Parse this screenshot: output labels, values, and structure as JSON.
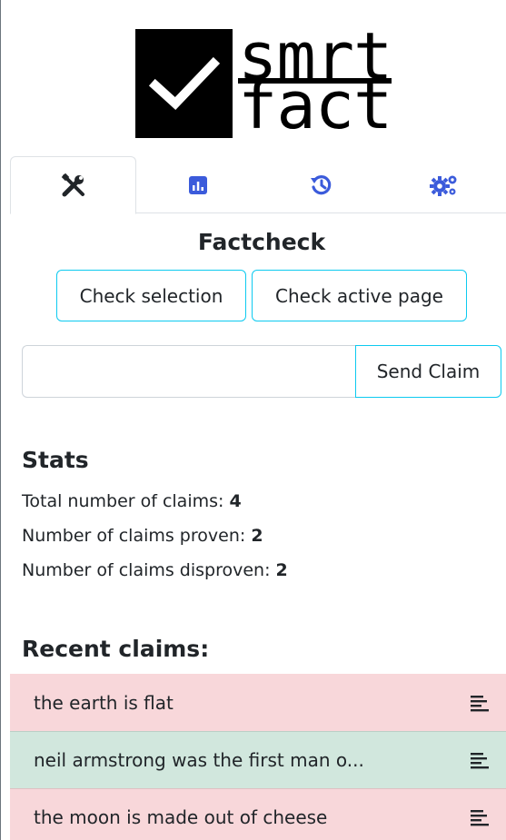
{
  "logo": {
    "line1": "smrt",
    "line2": "fact"
  },
  "tabs": [
    {
      "name": "tools",
      "icon": "tools-icon"
    },
    {
      "name": "stats",
      "icon": "bar-chart-icon"
    },
    {
      "name": "history",
      "icon": "history-icon"
    },
    {
      "name": "settings",
      "icon": "gears-icon"
    }
  ],
  "factcheck": {
    "title": "Factcheck",
    "check_selection_label": "Check selection",
    "check_page_label": "Check active page",
    "claim_value": "",
    "send_label": "Send Claim"
  },
  "stats": {
    "title": "Stats",
    "total_label": "Total number of claims: ",
    "total_value": "4",
    "proven_label": "Number of claims proven: ",
    "proven_value": "2",
    "disproven_label": "Number of claims disproven: ",
    "disproven_value": "2"
  },
  "recent": {
    "title": "Recent claims:",
    "items": [
      {
        "text": "the earth is flat",
        "status": "disproven",
        "color": "#f8d7da"
      },
      {
        "text": "neil armstrong was the first man o...",
        "status": "proven",
        "color": "#d1e7dd"
      },
      {
        "text": "the moon is made out of cheese",
        "status": "disproven",
        "color": "#f8d7da"
      }
    ]
  },
  "colors": {
    "accent": "#0dcaf0",
    "icon_blue": "#3b5bdb"
  }
}
